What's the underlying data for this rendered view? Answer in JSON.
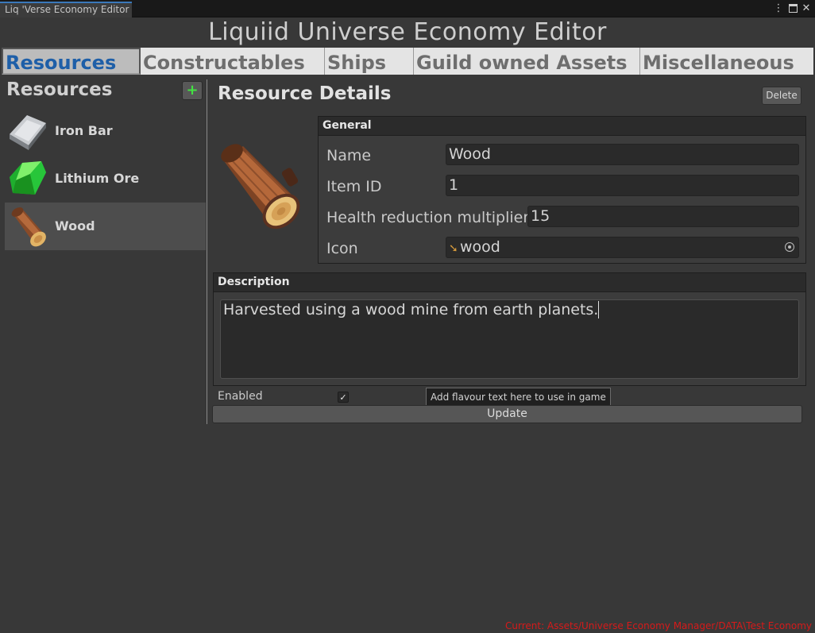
{
  "window": {
    "tab_title": "Liq 'Verse Economy Editor",
    "menu_icon": "kebab-menu-icon",
    "maximize_icon": "maximize-icon",
    "close_icon": "close-icon"
  },
  "app_title": "Liquiid Universe Economy Editor",
  "toolbar": {
    "tabs": [
      {
        "label": "Resources",
        "active": true
      },
      {
        "label": "Constructables",
        "active": false
      },
      {
        "label": "Ships",
        "active": false
      },
      {
        "label": "Guild owned Assets",
        "active": false
      },
      {
        "label": "Miscellaneous",
        "active": false
      }
    ]
  },
  "sidebar": {
    "title": "Resources",
    "add_label": "+",
    "items": [
      {
        "label": "Iron Bar",
        "icon": "iron-bar-icon",
        "selected": false
      },
      {
        "label": "Lithium Ore",
        "icon": "lithium-ore-icon",
        "selected": false
      },
      {
        "label": "Wood",
        "icon": "wood-log-icon",
        "selected": true
      }
    ]
  },
  "details": {
    "title": "Resource Details",
    "delete_label": "Delete",
    "general": {
      "header": "General",
      "name_label": "Name",
      "name_value": "Wood",
      "id_label": "Item ID",
      "id_value": "1",
      "health_label": "Health reduction multiplier",
      "health_value": "15",
      "icon_label": "Icon",
      "icon_value": "wood"
    },
    "description": {
      "header": "Description",
      "text": "Harvested using a wood mine from earth planets."
    },
    "enabled_label": "Enabled",
    "enabled": true,
    "tooltip": "Add flavour text here to use in game",
    "update_label": "Update"
  },
  "status": "Current: Assets/Universe Economy Manager/DATA\\Test Economy",
  "colors": {
    "accent": "#1e5fa8",
    "add_green": "#42e342",
    "status_red": "#d61a1a"
  }
}
